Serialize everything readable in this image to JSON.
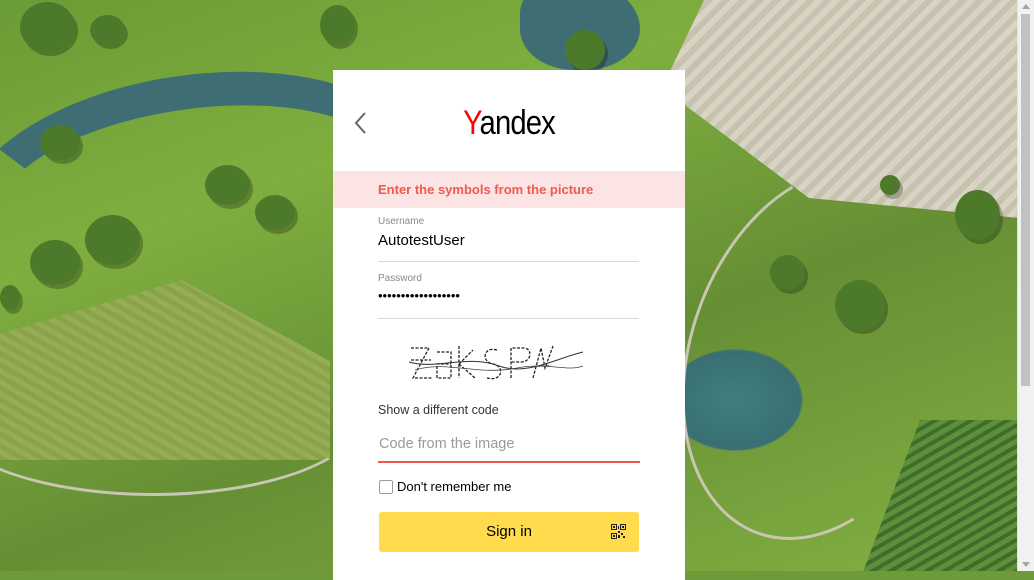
{
  "brand": {
    "logo_first_letter": "Y",
    "logo_rest": "andex",
    "colors": {
      "logo_red": "#ff0000",
      "error_text": "#f0594e",
      "error_bg": "#fde4e4",
      "signin_yellow": "#ffdb4d"
    }
  },
  "error": {
    "message": "Enter the symbols from the picture"
  },
  "username": {
    "label": "Username",
    "value": "AutotestUser"
  },
  "password": {
    "label": "Password",
    "value": "••••••••••••••••••"
  },
  "captcha": {
    "icon": "captcha-image",
    "show_different_label": "Show a different code"
  },
  "code_input": {
    "placeholder": "Code from the image",
    "value": ""
  },
  "remember": {
    "label": "Don't remember me",
    "checked": false
  },
  "signin": {
    "label": "Sign in",
    "qr_icon": "qr-code-icon"
  },
  "back": {
    "icon": "chevron-left-icon"
  }
}
